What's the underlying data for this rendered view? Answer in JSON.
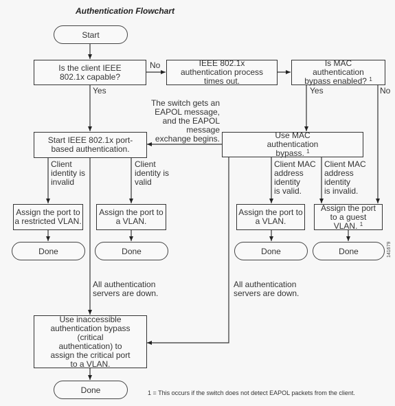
{
  "title": "Authentication Flowchart",
  "nodes": {
    "start": {
      "label": "Start"
    },
    "capable": {
      "label": "Is the client IEEE 802.1x capable?"
    },
    "timeout": {
      "label": "IEEE 802.1x authentication process times out."
    },
    "mab_enabled": {
      "label": "Is MAC authentication bypass enabled?",
      "sup": "1"
    },
    "start_8021x": {
      "label": "Start IEEE 802.1x port-based authentication."
    },
    "use_mab": {
      "label": "Use MAC authentication bypass.",
      "sup": "1"
    },
    "restricted_vlan": {
      "label": "Assign the port to a restricted VLAN."
    },
    "vlan_8021x": {
      "label": "Assign the port to a VLAN."
    },
    "vlan_mab": {
      "label": "Assign the port to a VLAN."
    },
    "guest_vlan": {
      "label": "Assign the port to a guest VLAN.",
      "sup": "1"
    },
    "done_1": {
      "label": "Done"
    },
    "done_2": {
      "label": "Done"
    },
    "done_3": {
      "label": "Done"
    },
    "done_4": {
      "label": "Done"
    },
    "critical": {
      "label": "Use inaccessible authentication bypass (critical authentication) to assign the critical port to a VLAN."
    },
    "done_5": {
      "label": "Done"
    }
  },
  "edge_labels": {
    "no_capable": "No",
    "yes_capable": "Yes",
    "yes_mab": "Yes",
    "no_mab": "No",
    "eapol": "The switch gets an\nEAPOL message,\nand the EAPOL\nmessage\nexchange begins.",
    "invalid_identity": "Client\nidentity is\ninvalid",
    "valid_identity": "Client\nidentity is\nvalid",
    "mac_valid": "Client MAC\naddress\nidentity\nis valid.",
    "mac_invalid": "Client MAC\naddress\nidentity\nis invalid.",
    "servers_down_left": "All authentication\nservers are down.",
    "servers_down_right": "All authentication\nservers are down."
  },
  "figure_id": "141679",
  "footnote": "1 = This occurs if the switch does not detect EAPOL packets from the client."
}
